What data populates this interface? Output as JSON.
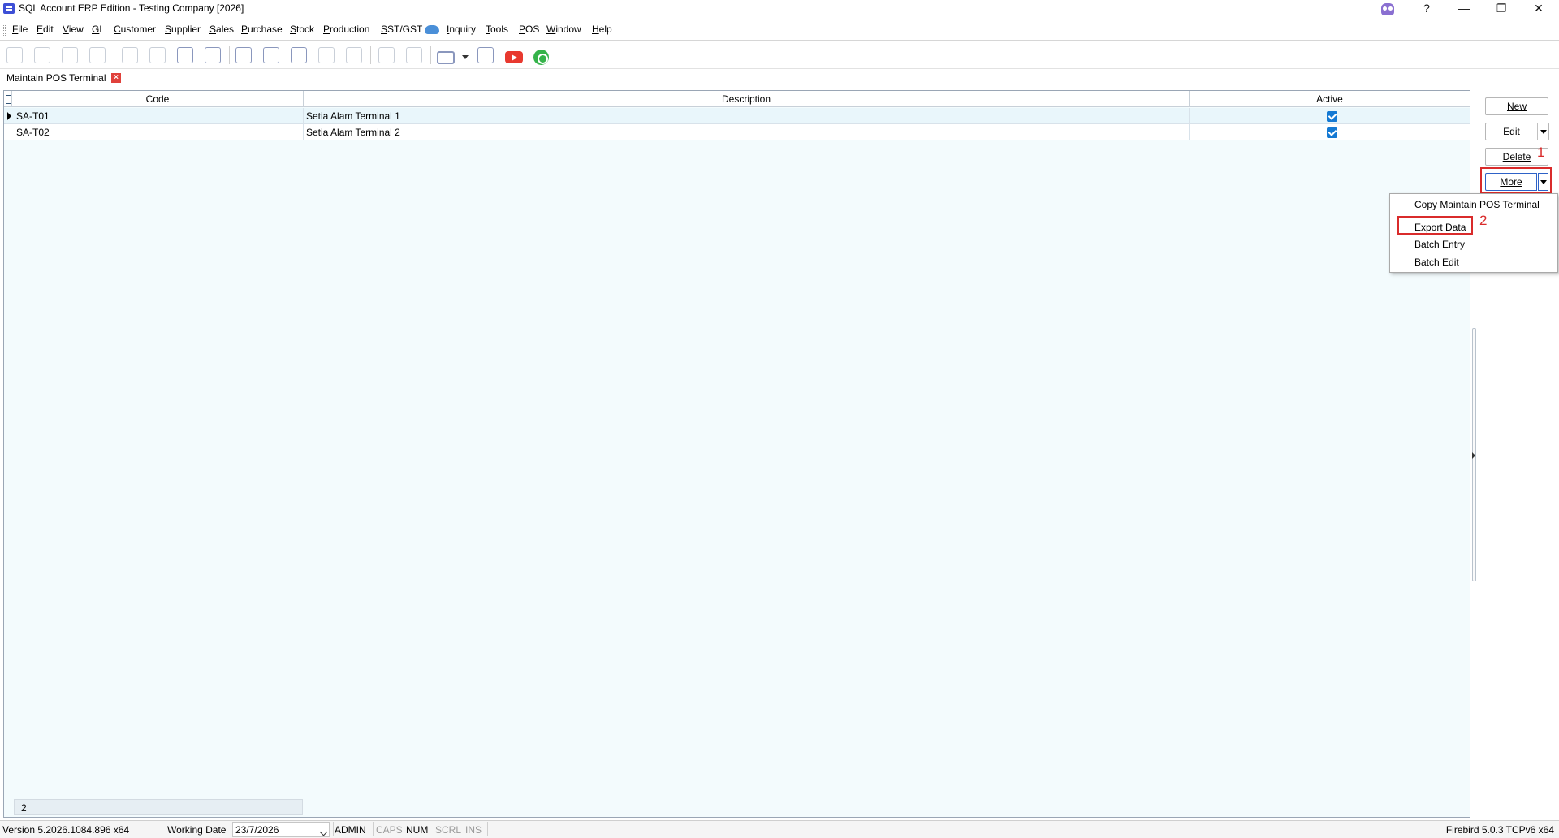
{
  "window": {
    "title": "SQL Account ERP Edition - Testing Company [2026]",
    "help_label": "?",
    "minimize_label": "—",
    "restore_label": "❐",
    "close_label": "✕"
  },
  "menu": {
    "items": [
      "File",
      "Edit",
      "View",
      "GL",
      "Customer",
      "Supplier",
      "Sales",
      "Purchase",
      "Stock",
      "Production",
      "SST/GST",
      "Inquiry",
      "Tools",
      "POS",
      "Window",
      "Help"
    ]
  },
  "tab": {
    "label": "Maintain POS Terminal",
    "close_label": "×"
  },
  "grid": {
    "columns": [
      "Code",
      "Description",
      "Active"
    ],
    "rows": [
      {
        "code": "SA-T01",
        "description": "Setia Alam Terminal 1",
        "active": true
      },
      {
        "code": "SA-T02",
        "description": "Setia Alam Terminal 2",
        "active": true
      }
    ],
    "footer_count": "2"
  },
  "actions": {
    "new_label": "New",
    "edit_label": "Edit",
    "delete_label": "Delete",
    "more_label": "More"
  },
  "annotations": {
    "step1": "1",
    "step2": "2",
    "highlight_color": "#d92b2b"
  },
  "dropdown": {
    "items": [
      "Copy Maintain POS Terminal",
      "Export Data",
      "Batch Entry",
      "Batch Edit"
    ]
  },
  "status": {
    "version": "Version 5.2026.1084.896 x64",
    "working_date_label": "Working Date",
    "working_date": "23/7/2026",
    "user": "ADMIN",
    "caps": "CAPS",
    "num": "NUM",
    "scrl": "SCRL",
    "ins": "INS",
    "db": "Firebird 5.0.3 TCPv6 x64"
  },
  "icons": [
    "app-icon",
    "owl-icon",
    "cloud-icon",
    "home-icon",
    "cut-icon",
    "copy-icon",
    "paste-icon",
    "first-icon",
    "prev-icon",
    "next-icon",
    "last-icon",
    "new-doc-icon",
    "edit-doc-icon",
    "delete-doc-icon",
    "save-icon",
    "cancel-icon",
    "search-icon",
    "refresh-icon",
    "print-icon",
    "preview-icon",
    "youtube-icon",
    "whatsapp-icon"
  ]
}
